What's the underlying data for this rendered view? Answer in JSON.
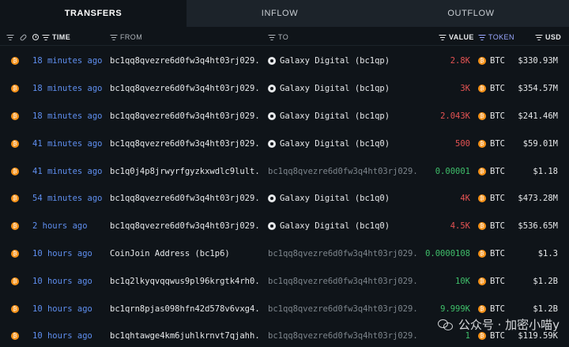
{
  "tabs": [
    {
      "label": "TRANSFERS",
      "active": true
    },
    {
      "label": "INFLOW",
      "active": false
    },
    {
      "label": "OUTFLOW",
      "active": false
    }
  ],
  "columns": {
    "time": "TIME",
    "from": "FROM",
    "to": "TO",
    "value": "VALUE",
    "token": "TOKEN",
    "usd": "USD"
  },
  "rows": [
    {
      "time": "18 minutes ago",
      "from": "bc1qq8qvezre6d0fw3q4ht03rj029...",
      "to": "Galaxy Digital (bc1qp)",
      "to_entity": true,
      "value": "2.8K",
      "value_color": "red",
      "token": "BTC",
      "usd": "$330.93M"
    },
    {
      "time": "18 minutes ago",
      "from": "bc1qq8qvezre6d0fw3q4ht03rj029...",
      "to": "Galaxy Digital (bc1qp)",
      "to_entity": true,
      "value": "3K",
      "value_color": "red",
      "token": "BTC",
      "usd": "$354.57M"
    },
    {
      "time": "18 minutes ago",
      "from": "bc1qq8qvezre6d0fw3q4ht03rj029...",
      "to": "Galaxy Digital (bc1qp)",
      "to_entity": true,
      "value": "2.043K",
      "value_color": "red",
      "token": "BTC",
      "usd": "$241.46M"
    },
    {
      "time": "41 minutes ago",
      "from": "bc1qq8qvezre6d0fw3q4ht03rj029...",
      "to": "Galaxy Digital (bc1q0)",
      "to_entity": true,
      "value": "500",
      "value_color": "red",
      "token": "BTC",
      "usd": "$59.01M"
    },
    {
      "time": "41 minutes ago",
      "from": "bc1q0j4p8jrwyrfgyzkxwdlc9lult...",
      "to": "bc1qq8qvezre6d0fw3q4ht03rj029...",
      "to_entity": false,
      "value": "0.00001",
      "value_color": "green",
      "token": "BTC",
      "usd": "$1.18"
    },
    {
      "time": "54 minutes ago",
      "from": "bc1qq8qvezre6d0fw3q4ht03rj029...",
      "to": "Galaxy Digital (bc1q0)",
      "to_entity": true,
      "value": "4K",
      "value_color": "red",
      "token": "BTC",
      "usd": "$473.28M"
    },
    {
      "time": "2 hours ago",
      "from": "bc1qq8qvezre6d0fw3q4ht03rj029...",
      "to": "Galaxy Digital (bc1q0)",
      "to_entity": true,
      "value": "4.5K",
      "value_color": "red",
      "token": "BTC",
      "usd": "$536.65M"
    },
    {
      "time": "10 hours ago",
      "from": "CoinJoin Address (bc1p6)",
      "to": "bc1qq8qvezre6d0fw3q4ht03rj029...",
      "to_entity": false,
      "value": "0.0000108",
      "value_color": "green",
      "token": "BTC",
      "usd": "$1.3"
    },
    {
      "time": "10 hours ago",
      "from": "bc1q2lkyqvqqwus9pl96krgtk4rh0...",
      "to": "bc1qq8qvezre6d0fw3q4ht03rj029...",
      "to_entity": false,
      "value": "10K",
      "value_color": "green",
      "token": "BTC",
      "usd": "$1.2B"
    },
    {
      "time": "10 hours ago",
      "from": "bc1qrn8pjas098hfn42d578v6vxg4...",
      "to": "bc1qq8qvezre6d0fw3q4ht03rj029...",
      "to_entity": false,
      "value": "9.999K",
      "value_color": "green",
      "token": "BTC",
      "usd": "$1.2B"
    },
    {
      "time": "10 hours ago",
      "from": "bc1qhtawge4km6juhlkrnvt7qjahh...",
      "to": "bc1qq8qvezre6d0fw3q4ht03rj029...",
      "to_entity": false,
      "value": "1",
      "value_color": "green",
      "token": "BTC",
      "usd": "$119.59K"
    }
  ],
  "colors": {
    "red": "#e55353",
    "green": "#3fbf6a",
    "time_blue": "#5f8ff0",
    "btc_orange": "#f7931a"
  },
  "icons": [
    "filter-icon",
    "link-icon",
    "clock-icon",
    "btc-icon",
    "entity-icon",
    "wechat-icon"
  ],
  "watermark": {
    "text": "公众号 · 加密小喵y"
  }
}
